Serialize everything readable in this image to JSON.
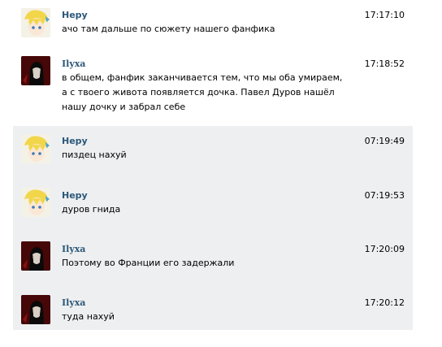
{
  "messages": [
    {
      "author": "Нерy",
      "time": "17:17:10",
      "lines": [
        "ачо там дальше по сюжету нашего фанфика"
      ],
      "avatar": "anime-avatar",
      "highlight": false
    },
    {
      "author": "Ilyxa",
      "time": "17:18:52",
      "lines": [
        "в общем, фанфик заканчивается тем, что мы оба умираем,",
        "а с твоего живота появляется дочка. Павел Дуров нашёл",
        "нашу дочку и забрал себе"
      ],
      "avatar": "dark-avatar",
      "highlight": false
    },
    {
      "author": "Нерy",
      "time": "07:19:49",
      "lines": [
        "пиздец нахуй"
      ],
      "avatar": "anime-avatar",
      "highlight": true
    },
    {
      "author": "Нерy",
      "time": "07:19:53",
      "lines": [
        "дуров гнида"
      ],
      "avatar": "anime-avatar",
      "highlight": true
    },
    {
      "author": "Ilyxa",
      "time": "17:20:09",
      "lines": [
        "Поэтому во Франции его задержали"
      ],
      "avatar": "dark-avatar",
      "highlight": true
    },
    {
      "author": "Ilyxa",
      "time": "17:20:12",
      "lines": [
        "туда нахуй"
      ],
      "avatar": "dark-avatar",
      "highlight": true
    }
  ]
}
